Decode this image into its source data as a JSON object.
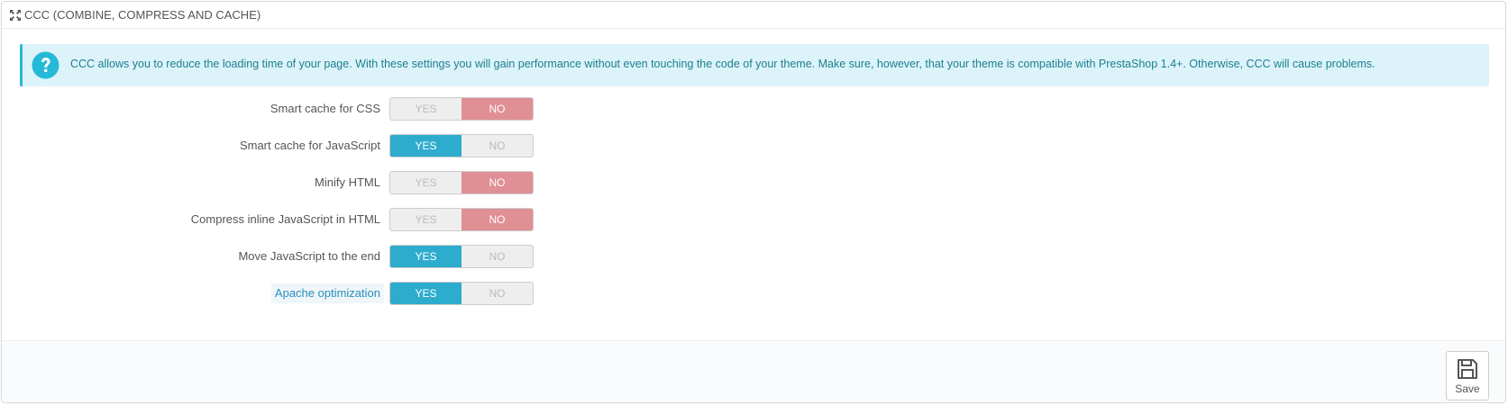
{
  "panel": {
    "title": "CCC (COMBINE, COMPRESS AND CACHE)",
    "title_icon": "fullscreen-arrows-icon"
  },
  "alert": {
    "icon": "question-circle-icon",
    "text": "CCC allows you to reduce the loading time of your page. With these settings you will gain performance without even touching the code of your theme. Make sure, however, that your theme is compatible with PrestaShop 1.4+. Otherwise, CCC will cause problems."
  },
  "settings": [
    {
      "label": "Smart cache for CSS",
      "yes": "YES",
      "no": "NO",
      "value": "no"
    },
    {
      "label": "Smart cache for JavaScript",
      "yes": "YES",
      "no": "NO",
      "value": "yes"
    },
    {
      "label": "Minify HTML",
      "yes": "YES",
      "no": "NO",
      "value": "no"
    },
    {
      "label": "Compress inline JavaScript in HTML",
      "yes": "YES",
      "no": "NO",
      "value": "no"
    },
    {
      "label": "Move JavaScript to the end",
      "yes": "YES",
      "no": "NO",
      "value": "yes"
    },
    {
      "label": "Apache optimization",
      "yes": "YES",
      "no": "NO",
      "value": "yes"
    }
  ],
  "footer": {
    "save_label": "Save",
    "save_icon": "floppy-disk-icon"
  },
  "colors": {
    "yes_active": "#2eacce",
    "no_active": "#e08f95",
    "alert_bg": "#dcf4f9",
    "alert_border": "#25b9d7",
    "alert_text": "#1e7d92"
  }
}
